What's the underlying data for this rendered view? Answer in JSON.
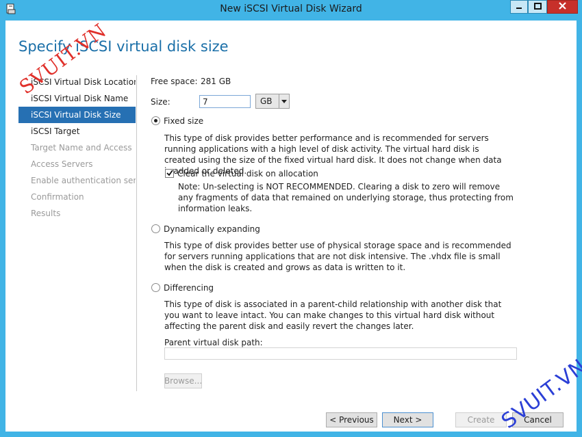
{
  "window": {
    "title": "New iSCSI Virtual Disk Wizard",
    "icons": {
      "app": "disk-wizard-icon",
      "minimize": "minimize-icon",
      "maximize": "maximize-icon",
      "close": "close-icon"
    }
  },
  "page": {
    "heading": "Specify iSCSI virtual disk size"
  },
  "steps": [
    {
      "label": "iSCSI Virtual Disk Location",
      "state": "completed"
    },
    {
      "label": "iSCSI Virtual Disk Name",
      "state": "completed"
    },
    {
      "label": "iSCSI Virtual Disk Size",
      "state": "active"
    },
    {
      "label": "iSCSI Target",
      "state": "completed"
    },
    {
      "label": "Target Name and Access",
      "state": "disabled"
    },
    {
      "label": "Access Servers",
      "state": "disabled"
    },
    {
      "label": "Enable authentication ser...",
      "state": "disabled"
    },
    {
      "label": "Confirmation",
      "state": "disabled"
    },
    {
      "label": "Results",
      "state": "disabled"
    }
  ],
  "form": {
    "free_space_label": "Free space:",
    "free_space_value": "281 GB",
    "size_label": "Size:",
    "size_value": "7",
    "unit": "GB",
    "fixed": {
      "label": "Fixed size",
      "checked": true,
      "description": "This type of disk provides better performance and is recommended for servers running applications with a high level of disk activity. The virtual hard disk is created using the size of the fixed virtual hard disk. It does not change when data is added or deleted.",
      "clear_label": "Clear the virtual disk on allocation",
      "clear_checked": true,
      "note": "Note: Un-selecting is NOT RECOMMENDED. Clearing a disk to zero will remove any fragments of data that remained on underlying storage, thus protecting from information leaks."
    },
    "dynamic": {
      "label": "Dynamically expanding",
      "checked": false,
      "description": "This type of disk provides better use of physical storage space and is recommended for servers running applications that are not disk intensive. The .vhdx file is small when the disk is created and grows as data is written to it."
    },
    "differencing": {
      "label": "Differencing",
      "checked": false,
      "description": "This type of disk is associated in a parent-child relationship with another disk that you want to leave intact. You can make changes to this virtual hard disk without affecting the parent disk and easily revert the changes later.",
      "parent_path_label": "Parent virtual disk path:",
      "parent_path_value": "",
      "browse_label": "Browse..."
    }
  },
  "buttons": {
    "previous": "< Previous",
    "next": "Next >",
    "create": "Create",
    "cancel": "Cancel"
  },
  "watermarks": {
    "top_left": "SVUIT.VN",
    "bottom_right": "SVUIT.VN"
  },
  "colors": {
    "title_bar": "#41b4e6",
    "active_step": "#2670b3",
    "heading": "#1a6fa8",
    "watermark_red": "#e0302a",
    "watermark_blue": "#2b3fd6"
  }
}
